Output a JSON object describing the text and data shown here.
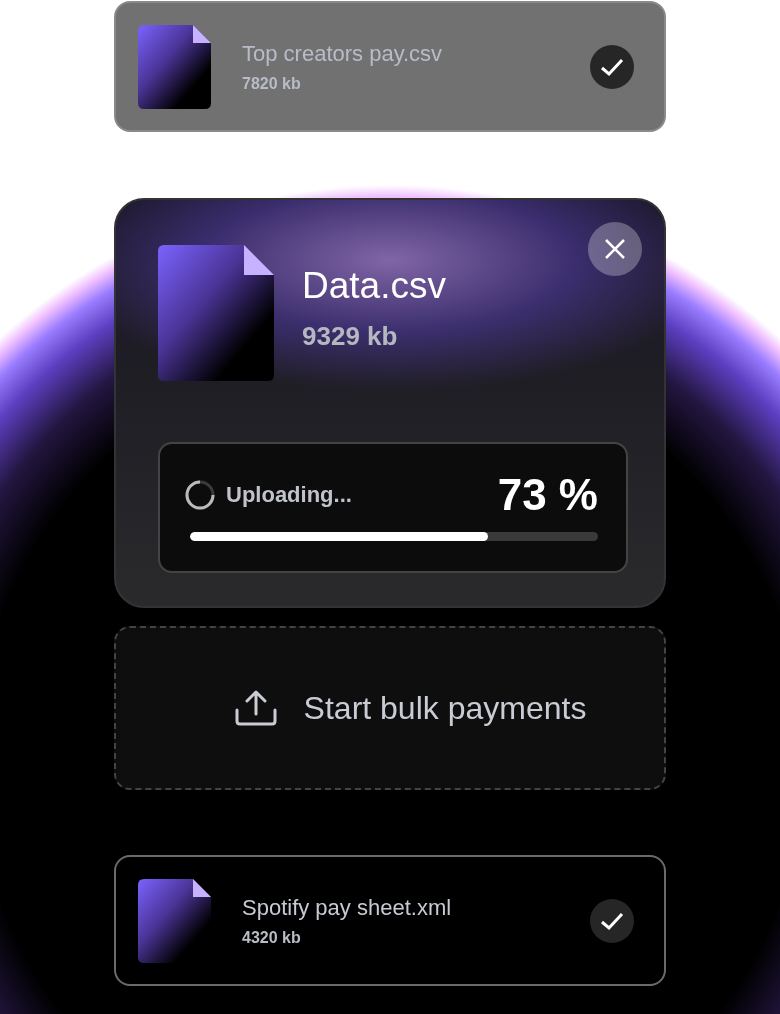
{
  "files_top": [
    {
      "name": "Top creators pay.csv",
      "size": "7820 kb",
      "completed": true,
      "dimmed": true
    }
  ],
  "upload": {
    "name": "Data.csv",
    "size": "9329 kb",
    "status": "Uploading...",
    "percent": "73 %",
    "level": 0.73
  },
  "drop_zone": {
    "label": "Start bulk payments"
  },
  "files_bottom": [
    {
      "name": "Spotify pay sheet.xml",
      "size": "4320 kb",
      "completed": true,
      "dimmed": false
    }
  ]
}
